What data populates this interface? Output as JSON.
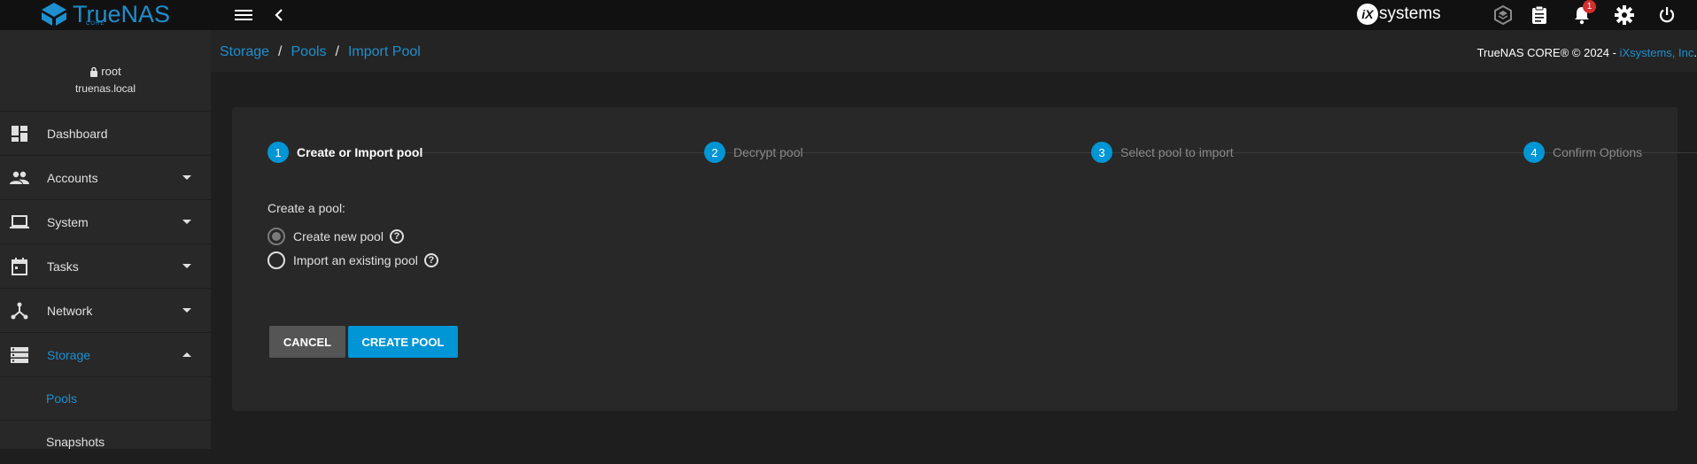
{
  "topbar": {
    "logo_text": "TrueNAS",
    "logo_sub": "CORE",
    "brand_mark": "iX",
    "brand_text": "systems",
    "notification_count": "1",
    "icons": [
      "menu-icon",
      "back-chevron-icon",
      "truecommand-icon",
      "clipboard-icon",
      "bell-icon",
      "gear-icon",
      "power-icon"
    ]
  },
  "sidebar": {
    "user": {
      "name": "root",
      "host": "truenas.local"
    },
    "items": [
      {
        "label": "Dashboard",
        "icon": "dashboard-icon"
      },
      {
        "label": "Accounts",
        "icon": "people-icon"
      },
      {
        "label": "System",
        "icon": "laptop-icon"
      },
      {
        "label": "Tasks",
        "icon": "calendar-icon"
      },
      {
        "label": "Network",
        "icon": "network-icon"
      },
      {
        "label": "Storage",
        "icon": "storage-icon"
      }
    ],
    "subitems": [
      {
        "label": "Pools"
      },
      {
        "label": "Snapshots"
      }
    ]
  },
  "breadcrumb": {
    "items": [
      "Storage",
      "Pools",
      "Import Pool"
    ],
    "separator": "/"
  },
  "copyright": {
    "text": "TrueNAS CORE® © 2024 - ",
    "link": "iXsystems, Inc",
    "end": "."
  },
  "wizard": {
    "steps": [
      {
        "num": "1",
        "label": "Create or Import pool"
      },
      {
        "num": "2",
        "label": "Decrypt pool"
      },
      {
        "num": "3",
        "label": "Select pool to import"
      },
      {
        "num": "4",
        "label": "Confirm Options"
      }
    ],
    "form_label": "Create a pool:",
    "options": [
      {
        "label": "Create new pool",
        "checked": true
      },
      {
        "label": "Import an existing pool",
        "checked": false
      }
    ],
    "help_glyph": "?",
    "cancel_label": "CANCEL",
    "create_label": "CREATE POOL"
  },
  "colors": {
    "accent": "#0095d5",
    "link": "#1e8fcf",
    "topbar": "#111111",
    "sidebar": "#282828",
    "badge": "#d32f2f"
  }
}
